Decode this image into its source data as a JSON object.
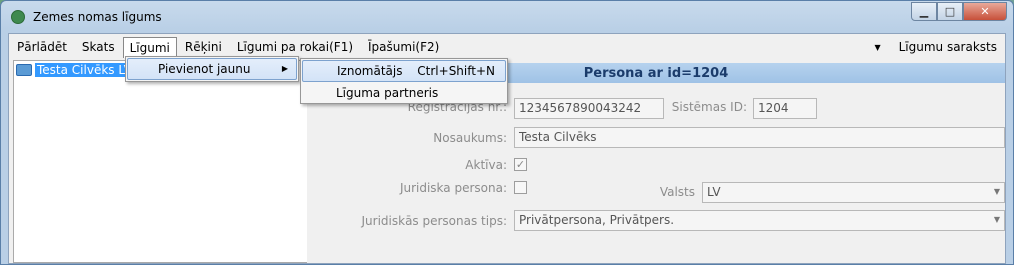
{
  "window": {
    "title": "Zemes nomas līgums"
  },
  "menu": {
    "items": [
      "Pārlādēt",
      "Skats",
      "Līgumi",
      "Rēķini",
      "Līgumi pa rokai(F1)",
      "Īpašumi(F2)"
    ],
    "right_label": "Līgumu saraksts"
  },
  "tree": {
    "selected": "Testa Cilvēks LV"
  },
  "submenu": {
    "item": "Pievienot jaunu",
    "subitems": [
      {
        "label": "Iznomātājs",
        "shortcut": "Ctrl+Shift+N"
      },
      {
        "label": "Līguma partneris",
        "shortcut": ""
      }
    ]
  },
  "detail": {
    "header": "Persona ar id=1204",
    "registration_label": "Reģistrācijas nr.:",
    "registration_value": "1234567890043242",
    "system_id_label": "Sistēmas ID:",
    "system_id_value": "1204",
    "name_label": "Nosaukums:",
    "name_value": "Testa Cilvēks",
    "active_label": "Aktīva:",
    "active_checked": true,
    "legal_label": "Juridiska persona:",
    "legal_checked": false,
    "country_label": "Valsts",
    "country_value": "LV",
    "legal_type_label": "Juridiskās personas tips:",
    "legal_type_value": "Privātpersona, Privātpers."
  },
  "colors": {
    "selection": "#3399ff",
    "header_bg": "#a8c8ec"
  }
}
